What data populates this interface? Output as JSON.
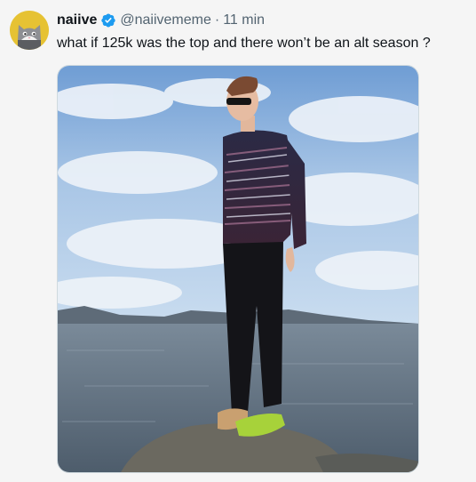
{
  "tweet": {
    "author_name": "naiive",
    "handle": "@naiivememe",
    "separator": "·",
    "time": "11 min",
    "text": "what if 125k was the top and there won’t be an alt season ?",
    "verified": true,
    "avatar_icon": "cat-avatar-icon",
    "verified_icon": "verified-badge-icon",
    "media_description": "photo"
  },
  "colors": {
    "verified_blue": "#1d9bf0",
    "secondary_text": "#536471",
    "primary_text": "#0f1419",
    "background": "#f5f5f5"
  }
}
